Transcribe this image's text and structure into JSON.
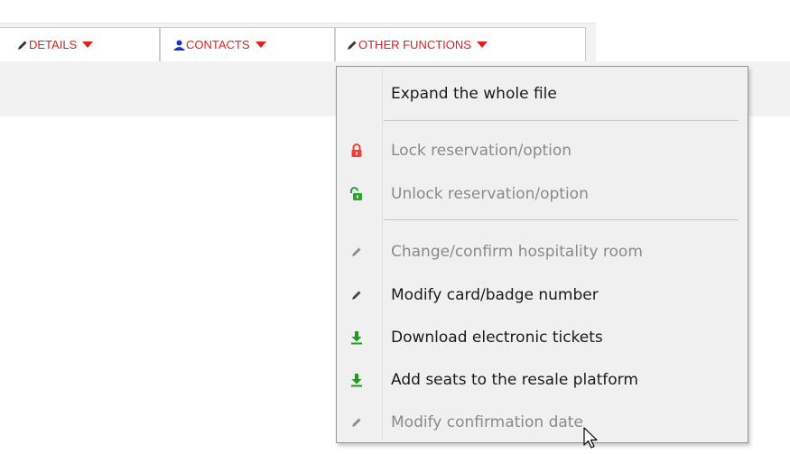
{
  "toolbar": {
    "tabs": [
      {
        "label": "DETAILS",
        "icon": "pencil-icon"
      },
      {
        "label": "CONTACTS",
        "icon": "user-icon"
      },
      {
        "label": "OTHER FUNCTIONS",
        "icon": "pencil-icon"
      }
    ]
  },
  "menu": {
    "items": [
      {
        "label": "Expand the whole file",
        "enabled": true
      },
      {
        "label": "Lock reservation/option",
        "icon": "lock-icon",
        "enabled": false
      },
      {
        "label": "Unlock reservation/option",
        "icon": "unlock-icon",
        "enabled": false
      },
      {
        "label": "Change/confirm hospitality room",
        "icon": "pencil-icon",
        "enabled": false
      },
      {
        "label": "Modify card/badge number",
        "icon": "pencil-icon",
        "enabled": true
      },
      {
        "label": "Download electronic tickets",
        "icon": "download-icon",
        "enabled": true
      },
      {
        "label": "Add seats to the resale platform",
        "icon": "download-icon",
        "enabled": true
      },
      {
        "label": "Modify confirmation date",
        "icon": "pencil-icon",
        "enabled": false
      }
    ]
  },
  "colors": {
    "tab_text": "#e0201b",
    "lock": "#e8423c",
    "unlock": "#2aa52a",
    "download": "#1f9a1f",
    "user_icon": "#1a2fd6"
  }
}
